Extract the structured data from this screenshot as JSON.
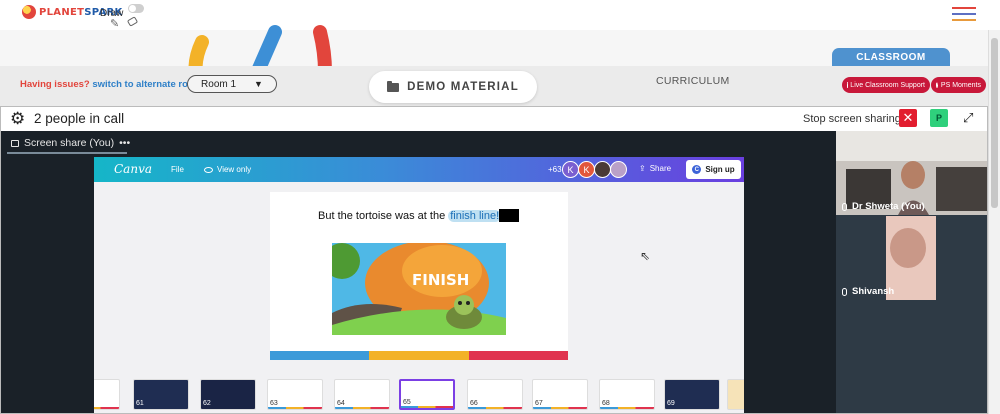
{
  "header": {
    "logo_text_1": "PLANET",
    "logo_text_2": "SPARK",
    "draw_label": "Draw",
    "draw_toggle_on": false,
    "brand_colors": {
      "red": "#e2453c",
      "blue": "#1f5aa8",
      "orange": "#e89a3c"
    }
  },
  "room_bar": {
    "issues_text": "Having issues?",
    "alternate_link": "switch to alternate room",
    "room_selected": "Room 1",
    "demo_material": "DEMO MATERIAL",
    "curriculum": "CURRICULUM",
    "classroom_tab": "CLASSROOM",
    "live_support": "Live Classroom Support",
    "ps_moments": "PS Moments"
  },
  "call": {
    "people_count": "2 people in call",
    "stop_sharing": "Stop screen sharing",
    "p_button": "P",
    "share_label": "Screen share (You)",
    "participants": [
      {
        "name": "Dr Shweta (You)"
      },
      {
        "name": "Shivansh"
      }
    ]
  },
  "canva": {
    "logo": "Canva",
    "file": "File",
    "view_only": "View only",
    "viewer_count": "+63",
    "avatars": [
      "K",
      "K"
    ],
    "share": "Share",
    "signup": "Sign up",
    "slide_text_before": "But the tortoise was at the",
    "slide_text_highlight": "finish line!",
    "slide_sign": "FINISH",
    "thumbnails": [
      "61",
      "62",
      "63",
      "64",
      "65",
      "66",
      "67",
      "68",
      "69"
    ],
    "selected_thumbnail": "65"
  }
}
